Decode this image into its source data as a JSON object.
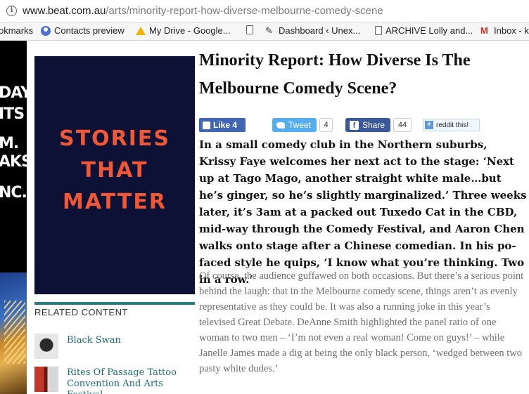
{
  "browser": {
    "url_host": "www.beat.com.au",
    "url_path": "/arts/minority-report-how-diverse-melbourne-comedy-scene",
    "bookmarks": [
      {
        "label": "okmarks",
        "icon": "none"
      },
      {
        "label": "Contacts preview",
        "icon": "person-icon"
      },
      {
        "label": "My Drive - Google...",
        "icon": "drive-icon"
      },
      {
        "label": "",
        "icon": "page-icon"
      },
      {
        "label": "Dashboard ‹ Unex...",
        "icon": "dashboard-icon"
      },
      {
        "label": "ARCHIVE Lolly and...",
        "icon": "page-icon"
      },
      {
        "label": "Inbox - k",
        "icon": "gmail-icon"
      }
    ]
  },
  "left_ad": {
    "lines": [
      "DAY",
      "ITS",
      "M.",
      "AKS.",
      "NC."
    ]
  },
  "sidebar": {
    "feature_text": [
      "STORIES",
      "THAT",
      "MATTER"
    ],
    "related_title": "RELATED CONTENT",
    "related": [
      {
        "title": "Black Swan"
      },
      {
        "title": "Rites Of Passage Tattoo Convention And Arts Festival"
      }
    ]
  },
  "article": {
    "headline": "Minority Report: How Diverse Is The Melbourne Comedy Scene?",
    "social": {
      "like_label": "Like 4",
      "tweet_label": "Tweet",
      "tweet_count": "4",
      "share_label": "Share",
      "share_count": "44",
      "reddit_label": "reddit this!"
    },
    "lede": "In a small comedy club in the Northern suburbs, Krissy Faye welcomes her next act to the stage: ‘Next up at Tago Mago, another straight white male…but he’s ginger, so he’s slightly marginalized.’ Three weeks later, it’s 3am at a packed out Tuxedo Cat in the CBD, mid-way through the Comedy Festival, and Aaron Chen walks onto stage after a Chinese comedian. In his po-faced style he quips, ‘I know what you’re thinking. Two in a row.’",
    "body": "Of course, the audience guffawed on both occasions. But there’s a serious point behind the laugh: that in the Melbourne comedy scene, things aren’t as evenly representative as they could be. It was also a running joke in this year’s televised Great Debate. DeAnne Smith highlighted the panel ratio of one woman to two men – ‘I’m not even a real woman! Come on guys!’ – while Janelle James made a dig at being the only black person, ‘wedged between two pasty white dudes.’"
  },
  "colors": {
    "feature_bg": "#0d1136",
    "feature_text": "#ef5736",
    "accent_teal": "#2a7a7e",
    "facebook": "#4267b2",
    "twitter": "#55acee"
  }
}
